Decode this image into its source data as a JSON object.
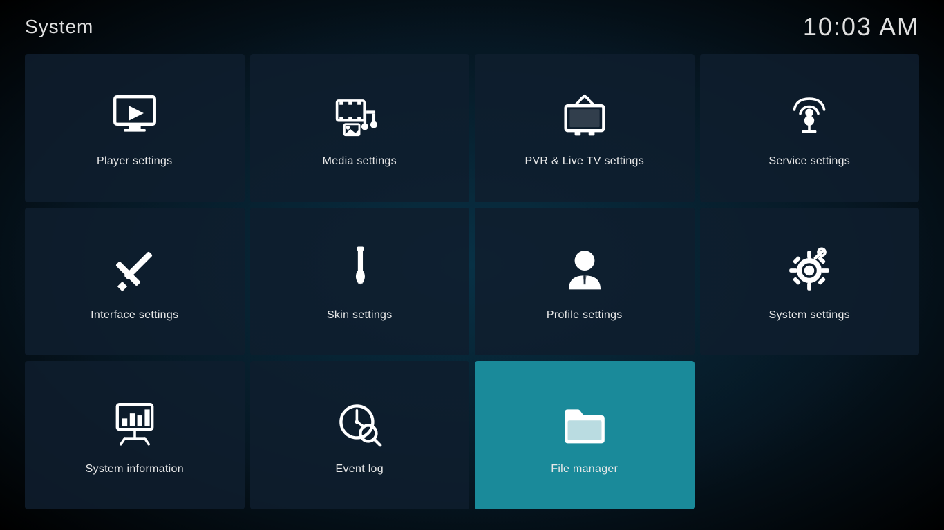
{
  "header": {
    "title": "System",
    "time": "10:03 AM"
  },
  "tiles": [
    {
      "id": "player-settings",
      "label": "Player settings",
      "icon": "player",
      "active": false
    },
    {
      "id": "media-settings",
      "label": "Media settings",
      "icon": "media",
      "active": false
    },
    {
      "id": "pvr-settings",
      "label": "PVR & Live TV settings",
      "icon": "pvr",
      "active": false
    },
    {
      "id": "service-settings",
      "label": "Service settings",
      "icon": "service",
      "active": false
    },
    {
      "id": "interface-settings",
      "label": "Interface settings",
      "icon": "interface",
      "active": false
    },
    {
      "id": "skin-settings",
      "label": "Skin settings",
      "icon": "skin",
      "active": false
    },
    {
      "id": "profile-settings",
      "label": "Profile settings",
      "icon": "profile",
      "active": false
    },
    {
      "id": "system-settings",
      "label": "System settings",
      "icon": "system",
      "active": false
    },
    {
      "id": "system-information",
      "label": "System information",
      "icon": "sysinfo",
      "active": false
    },
    {
      "id": "event-log",
      "label": "Event log",
      "icon": "eventlog",
      "active": false
    },
    {
      "id": "file-manager",
      "label": "File manager",
      "icon": "filemanager",
      "active": true
    }
  ]
}
